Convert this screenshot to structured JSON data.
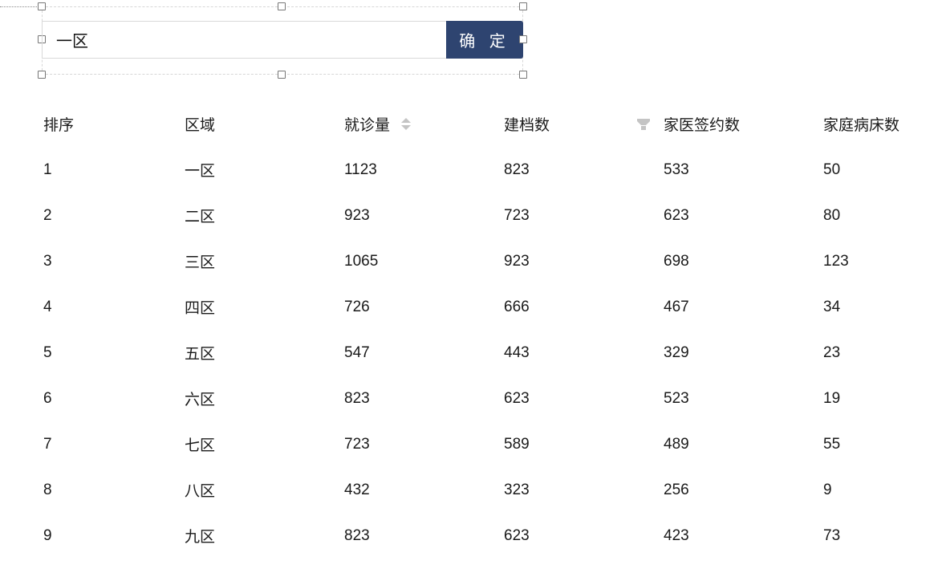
{
  "search": {
    "value": "一区",
    "confirm_label": "确 定"
  },
  "table": {
    "columns": [
      {
        "label": "排序"
      },
      {
        "label": "区域"
      },
      {
        "label": "就诊量",
        "sortable": true
      },
      {
        "label": "建档数",
        "filterable": true
      },
      {
        "label": "家医签约数"
      },
      {
        "label": "家庭病床数"
      }
    ],
    "rows": [
      [
        "1",
        "一区",
        "1123",
        "823",
        "533",
        "50"
      ],
      [
        "2",
        "二区",
        "923",
        "723",
        "623",
        "80"
      ],
      [
        "3",
        "三区",
        "1065",
        "923",
        "698",
        "123"
      ],
      [
        "4",
        "四区",
        "726",
        "666",
        "467",
        "34"
      ],
      [
        "5",
        "五区",
        "547",
        "443",
        "329",
        "23"
      ],
      [
        "6",
        "六区",
        "823",
        "623",
        "523",
        "19"
      ],
      [
        "7",
        "七区",
        "723",
        "589",
        "489",
        "55"
      ],
      [
        "8",
        "八区",
        "432",
        "323",
        "256",
        "9"
      ],
      [
        "9",
        "九区",
        "823",
        "623",
        "423",
        "73"
      ]
    ]
  },
  "colors": {
    "confirm_button": "#2e4470",
    "icon_gray": "#c4c4c4"
  }
}
